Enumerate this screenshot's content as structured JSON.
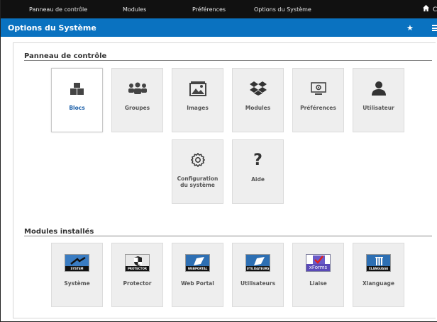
{
  "topbar": {
    "items": [
      "Panneau de contrôle",
      "Modules",
      "Préférences",
      "Options du Système"
    ],
    "trailing": "C"
  },
  "titlebar": {
    "title": "Options du Système"
  },
  "control_panel": {
    "heading": "Panneau de contrôle",
    "tiles": [
      {
        "label": "Blocs",
        "icon": "blocks-icon",
        "active": true
      },
      {
        "label": "Groupes",
        "icon": "users-group-icon"
      },
      {
        "label": "Images",
        "icon": "image-icon"
      },
      {
        "label": "Modules",
        "icon": "dropbox-modules-icon"
      },
      {
        "label": "Préférences",
        "icon": "monitor-settings-icon"
      },
      {
        "label": "Utilisateur",
        "icon": "user-icon"
      },
      {
        "label": "Configuration du système",
        "icon": "gear-icon"
      },
      {
        "label": "Aide",
        "icon": "question-icon"
      }
    ]
  },
  "installed_modules": {
    "heading": "Modules installés",
    "tiles": [
      {
        "label": "Système",
        "badge": "SYSTEM"
      },
      {
        "label": "Protector",
        "badge": "PROTECTOR"
      },
      {
        "label": "Web Portal",
        "badge": "WEBPORTAL"
      },
      {
        "label": "Utilisateurs",
        "badge": "UTILISATEURS"
      },
      {
        "label": "Liaise",
        "badge": "xForms"
      },
      {
        "label": "Xlanguage",
        "badge": "XLANGUAGE"
      }
    ]
  },
  "colors": {
    "topbar": "#111111",
    "titlebar": "#0a72c0",
    "active_label": "#1a5ea8",
    "tile_bg": "#eeeeee"
  }
}
